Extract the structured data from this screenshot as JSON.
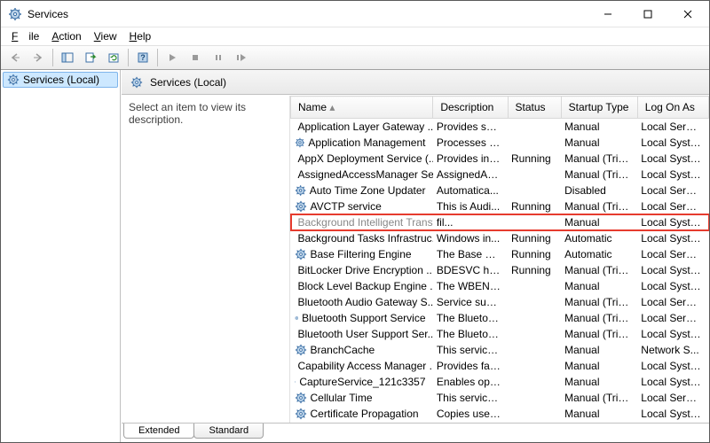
{
  "window": {
    "title": "Services"
  },
  "menu": {
    "file": "File",
    "action": "Action",
    "view": "View",
    "help": "Help"
  },
  "tree": {
    "root": "Services (Local)"
  },
  "panel": {
    "heading": "Services (Local)",
    "prompt": "Select an item to view its description."
  },
  "columns": {
    "name": "Name",
    "description": "Description",
    "status": "Status",
    "startup": "Startup Type",
    "logon": "Log On As"
  },
  "tabs": {
    "extended": "Extended",
    "standard": "Standard"
  },
  "services": [
    {
      "name": "Application Layer Gateway ...",
      "desc": "Provides su...",
      "status": "",
      "startup": "Manual",
      "logon": "Local Service"
    },
    {
      "name": "Application Management",
      "desc": "Processes in...",
      "status": "",
      "startup": "Manual",
      "logon": "Local Syste..."
    },
    {
      "name": "AppX Deployment Service (...",
      "desc": "Provides inf...",
      "status": "Running",
      "startup": "Manual (Trig...",
      "logon": "Local Syste..."
    },
    {
      "name": "AssignedAccessManager Se...",
      "desc": "AssignedAc...",
      "status": "",
      "startup": "Manual (Trig...",
      "logon": "Local Syste..."
    },
    {
      "name": "Auto Time Zone Updater",
      "desc": "Automatica...",
      "status": "",
      "startup": "Disabled",
      "logon": "Local Service"
    },
    {
      "name": "AVCTP service",
      "desc": "This is Audi...",
      "status": "Running",
      "startup": "Manual (Trig...",
      "logon": "Local Service"
    },
    {
      "name": "Background Intelligent Transfer Service",
      "desc": "fil...",
      "status": "",
      "startup": "Manual",
      "logon": "Local Syste...",
      "highlight": true
    },
    {
      "name": "Background Tasks Infrastruc...",
      "desc": "Windows in...",
      "status": "Running",
      "startup": "Automatic",
      "logon": "Local Syste..."
    },
    {
      "name": "Base Filtering Engine",
      "desc": "The Base Fil...",
      "status": "Running",
      "startup": "Automatic",
      "logon": "Local Service"
    },
    {
      "name": "BitLocker Drive Encryption ...",
      "desc": "BDESVC hos...",
      "status": "Running",
      "startup": "Manual (Trig...",
      "logon": "Local Syste..."
    },
    {
      "name": "Block Level Backup Engine ...",
      "desc": "The WBENG...",
      "status": "",
      "startup": "Manual",
      "logon": "Local Syste..."
    },
    {
      "name": "Bluetooth Audio Gateway S...",
      "desc": "Service sup...",
      "status": "",
      "startup": "Manual (Trig...",
      "logon": "Local Service"
    },
    {
      "name": "Bluetooth Support Service",
      "desc": "The Bluetoo...",
      "status": "",
      "startup": "Manual (Trig...",
      "logon": "Local Service"
    },
    {
      "name": "Bluetooth User Support Ser...",
      "desc": "The Bluetoo...",
      "status": "",
      "startup": "Manual (Trig...",
      "logon": "Local Syste..."
    },
    {
      "name": "BranchCache",
      "desc": "This service ...",
      "status": "",
      "startup": "Manual",
      "logon": "Network S..."
    },
    {
      "name": "Capability Access Manager ...",
      "desc": "Provides fac...",
      "status": "",
      "startup": "Manual",
      "logon": "Local Syste..."
    },
    {
      "name": "CaptureService_121c3357",
      "desc": "Enables opti...",
      "status": "",
      "startup": "Manual",
      "logon": "Local Syste..."
    },
    {
      "name": "Cellular Time",
      "desc": "This service ...",
      "status": "",
      "startup": "Manual (Trig...",
      "logon": "Local Service"
    },
    {
      "name": "Certificate Propagation",
      "desc": "Copies user ...",
      "status": "",
      "startup": "Manual",
      "logon": "Local Syste..."
    }
  ]
}
